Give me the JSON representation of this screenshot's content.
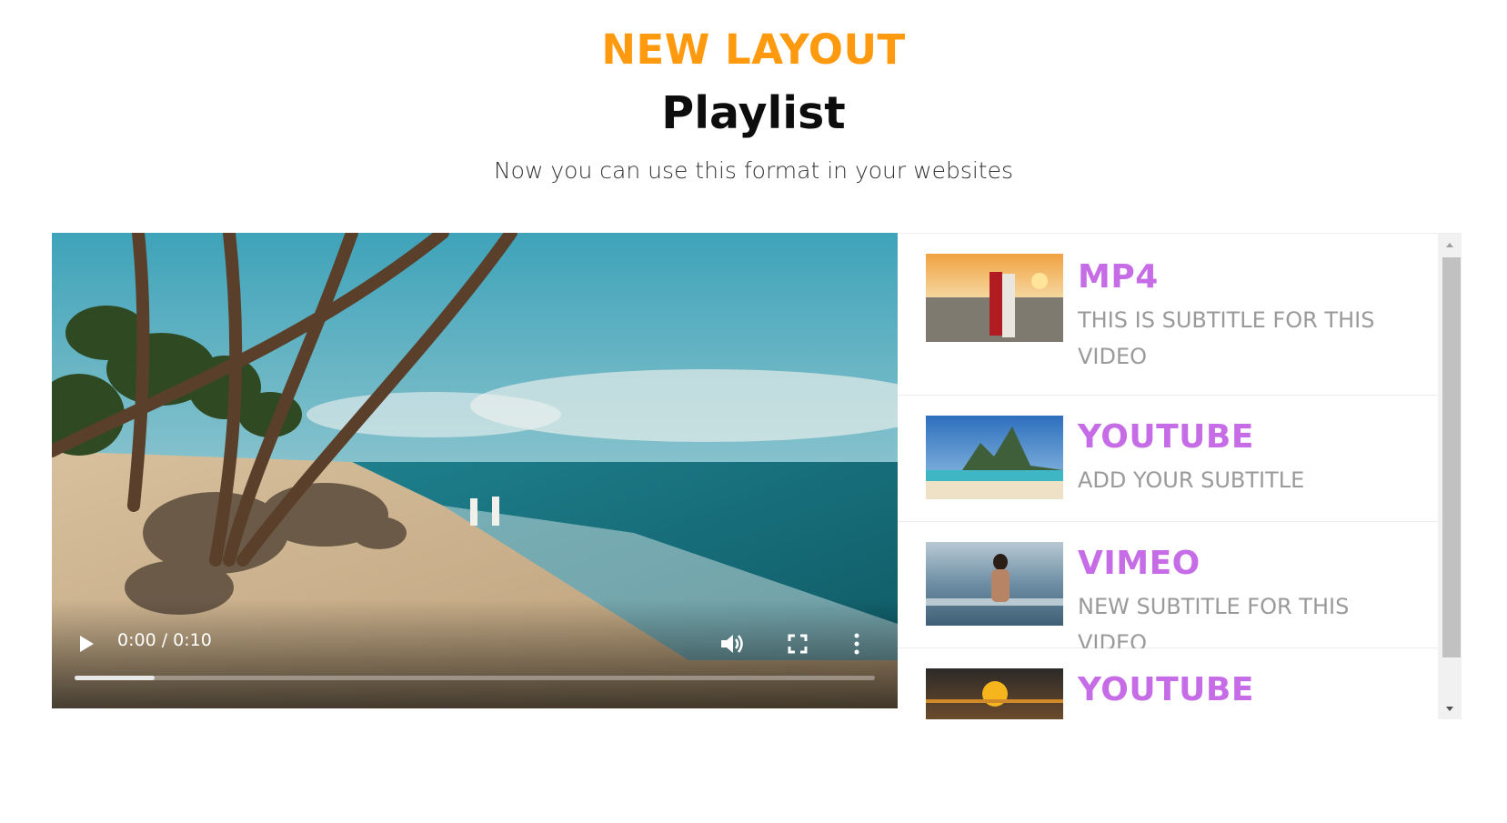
{
  "header": {
    "eyebrow": "NEW LAYOUT",
    "title": "Playlist",
    "subtitle": "Now you can use this format in your websites"
  },
  "player": {
    "time": "0:00 / 0:10",
    "progress": 0.1,
    "icons": {
      "play": "play-icon",
      "volume": "volume-icon",
      "fullscreen": "fullscreen-icon",
      "more": "more-vertical-icon"
    }
  },
  "playlist": {
    "items": [
      {
        "title": "MP4",
        "subtitle": "THIS IS SUBTITLE FOR THIS VIDEO"
      },
      {
        "title": "YOUTUBE",
        "subtitle": "ADD YOUR SUBTITLE"
      },
      {
        "title": "VIMEO",
        "subtitle": "NEW SUBTITLE FOR THIS VIDEO"
      },
      {
        "title": "YOUTUBE",
        "subtitle": ""
      }
    ]
  },
  "colors": {
    "accent_orange": "#ff9a0e",
    "accent_purple": "#c56ce6",
    "subtitle_gray": "#9a9a9a"
  }
}
